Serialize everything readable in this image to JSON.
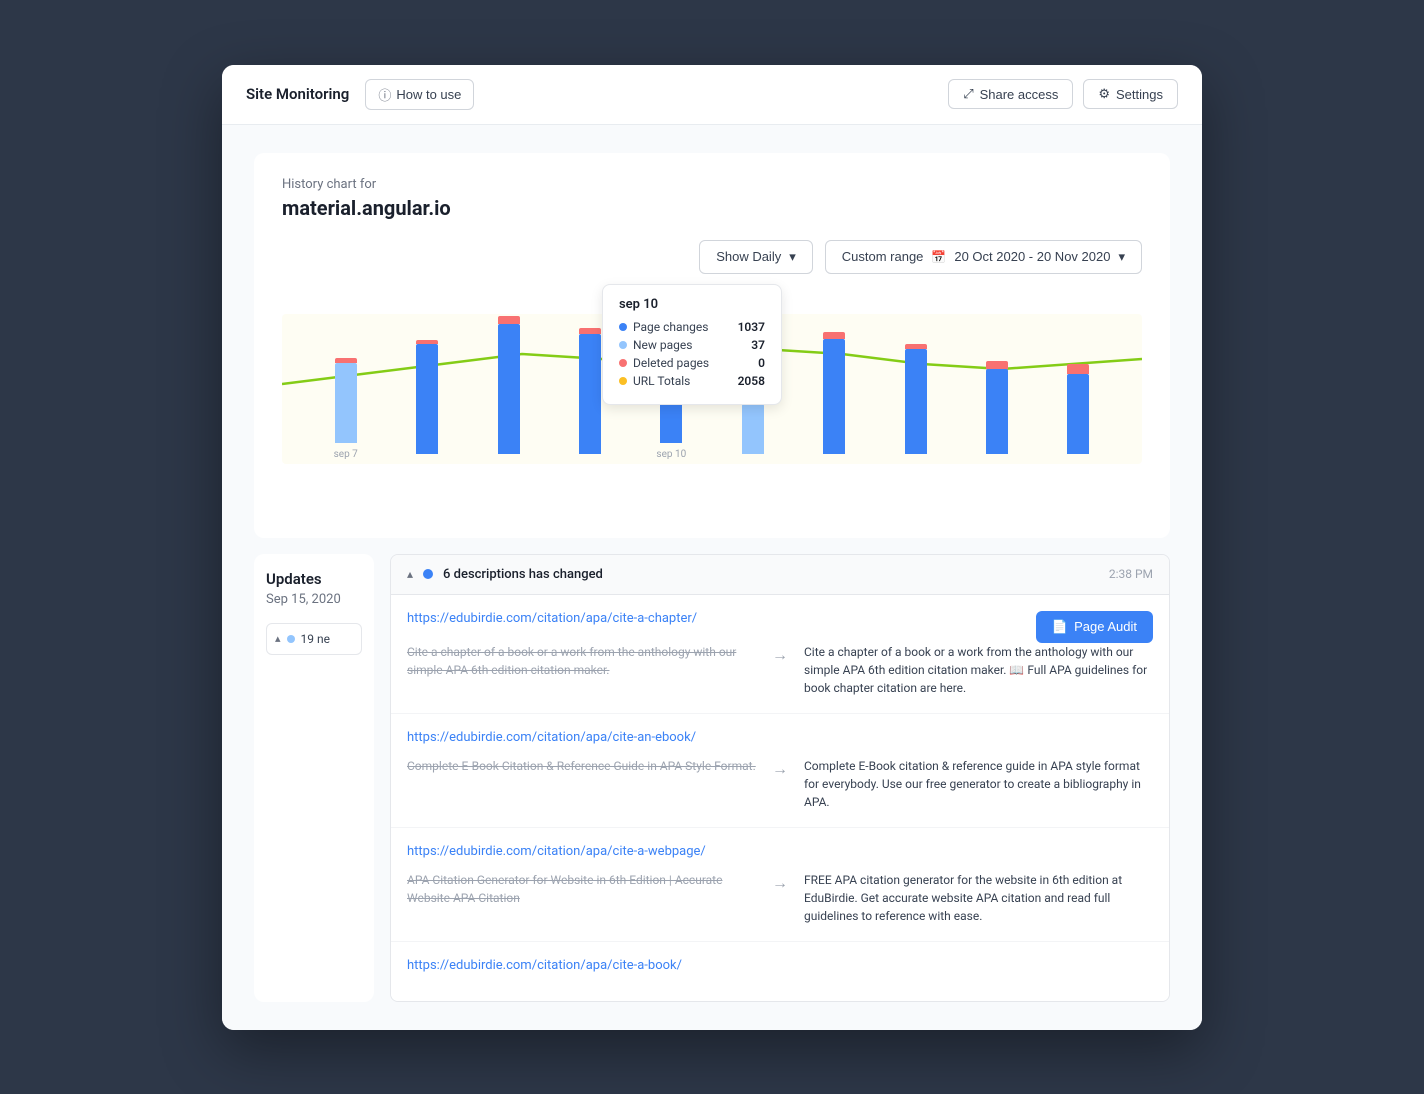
{
  "header": {
    "title": "Site Monitoring",
    "how_to_use": "How to use",
    "share_access": "Share access",
    "settings": "Settings"
  },
  "chart_section": {
    "history_label": "History chart for",
    "domain": "material.angular.io",
    "show_daily": "Show Daily",
    "date_range_label": "Custom range",
    "date_range": "20 Oct 2020 - 20 Nov 2020"
  },
  "tooltip": {
    "date": "sep 10",
    "rows": [
      {
        "label": "Page changes",
        "value": "1037",
        "color": "#3b82f6"
      },
      {
        "label": "New pages",
        "value": "37",
        "color": "#93c5fd"
      },
      {
        "label": "Deleted pages",
        "value": "0",
        "color": "#f87171"
      },
      {
        "label": "URL Totals",
        "value": "2058",
        "color": "#fbbf24"
      }
    ]
  },
  "bars": [
    {
      "label": "sep 7",
      "blue": 80,
      "pink": 5,
      "light": 10
    },
    {
      "label": "",
      "blue": 110,
      "pink": 4,
      "light": 12
    },
    {
      "label": "",
      "blue": 130,
      "pink": 8,
      "light": 10
    },
    {
      "label": "",
      "blue": 120,
      "pink": 6,
      "light": 14
    },
    {
      "label": "sep 10",
      "blue": 100,
      "pink": 3,
      "light": 8,
      "active": true
    },
    {
      "label": "",
      "blue": 50,
      "pink": 2,
      "light": 6
    },
    {
      "label": "",
      "blue": 115,
      "pink": 7,
      "light": 11
    },
    {
      "label": "",
      "blue": 105,
      "pink": 5,
      "light": 9
    },
    {
      "label": "",
      "blue": 90,
      "pink": 8,
      "light": 12
    },
    {
      "label": "",
      "blue": 80,
      "pink": 10,
      "light": 8
    }
  ],
  "updates": {
    "title": "Updates",
    "date": "Sep 15, 2020",
    "change_group": {
      "title": "6 descriptions has changed",
      "time": "2:38 PM",
      "dot_color": "#3b82f6"
    },
    "items": [
      {
        "url": "https://edubirdie.com/citation/apa/cite-a-chapter/",
        "before": "Cite a chapter of a book or a work from the anthology with our simple APA 6th edition citation maker.",
        "after": "Cite a chapter of a book or a work from the anthology with our simple APA 6th edition citation maker. 📖 Full APA guidelines for book chapter citation are here.",
        "show_audit": true
      },
      {
        "url": "https://edubirdie.com/citation/apa/cite-an-ebook/",
        "before": "Complete E-Book Citation & Reference Guide in APA Style Format.",
        "after": "Complete E-Book citation & reference guide in APA style format for everybody. Use our free generator to create a bibliography in APA.",
        "show_audit": false
      },
      {
        "url": "https://edubirdie.com/citation/apa/cite-a-webpage/",
        "before": "APA Citation Generator for Website in 6th Edition | Accurate Website APA Citation",
        "after": "FREE APA citation generator for the website in 6th edition at EduBirdie. Get accurate website APA citation and read full guidelines to reference with ease.",
        "show_audit": false
      },
      {
        "url": "https://edubirdie.com/citation/apa/cite-a-book/",
        "before": "",
        "after": "",
        "show_audit": false,
        "partial": true
      }
    ]
  },
  "side_updates": {
    "title": "Updates",
    "date": "Sep 15, 2020",
    "badge_label": "19 ne"
  },
  "page_audit_label": "Page Audit",
  "icons": {
    "info": "ⓘ",
    "share": "⤢",
    "settings": "⚙",
    "chevron_down": "▾",
    "chevron_up": "▴",
    "calendar": "📅",
    "arrow_right": "→",
    "document": "📄"
  }
}
